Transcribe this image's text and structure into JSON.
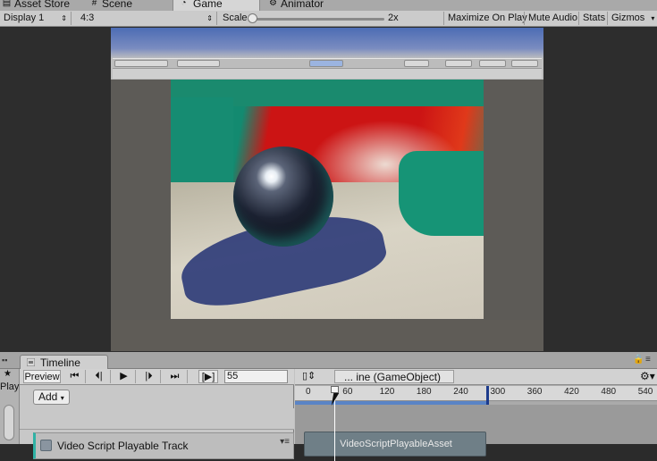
{
  "top_tabs": {
    "asset_store": "Asset Store",
    "scene": "Scene",
    "game": "Game",
    "animator": "Animator"
  },
  "game_toolbar": {
    "display": "Display 1",
    "aspect": "4:3",
    "scale_label": "Scale",
    "scale_value": "2x",
    "maximize": "Maximize On Play",
    "mute": "Mute Audio",
    "stats": "Stats",
    "gizmos": "Gizmos"
  },
  "timeline": {
    "tab_label": "Timeline",
    "preview_label": "Preview",
    "frame_value": "55",
    "add_label": "Add",
    "breadcrumb": "... ine (GameObject)",
    "track_name": "Video Script Playable Track",
    "clip_name": "VideoScriptPlayableAsset",
    "ruler_ticks": [
      "0",
      "60",
      "120",
      "180",
      "240",
      "300",
      "360",
      "420",
      "480",
      "540"
    ],
    "side_label": "Play"
  },
  "colors": {
    "track_accent": "#2fb2a5",
    "clip_fill": "#6f7f87",
    "range_bar": "#5a84c6",
    "end_marker": "#1d3b8c"
  }
}
